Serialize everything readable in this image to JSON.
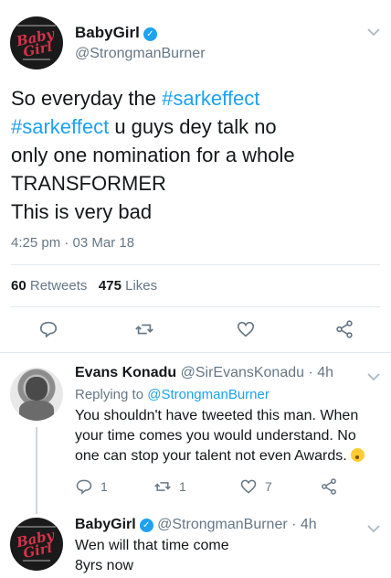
{
  "main_tweet": {
    "avatar": {
      "logo_text": "Baby Girl"
    },
    "display_name": "BabyGirl",
    "handle": "@StrongmanBurner",
    "text_lines": [
      {
        "plain": "So everyday the ",
        "tag": "#sarkeffect"
      },
      {
        "tag": "#sarkeffect",
        "plain": " u guys dey talk no"
      },
      {
        "plain": "only one nomination for a whole"
      },
      {
        "plain": "TRANSFORMER"
      },
      {
        "plain": "This is very bad"
      }
    ],
    "timestamp": "4:25 pm · 03 Mar 18",
    "retweets_count": "60",
    "retweets_label": "Retweets",
    "likes_count": "475",
    "likes_label": "Likes"
  },
  "reply1": {
    "display_name": "Evans Konadu",
    "handle_time": "@SirEvansKonadu · 4h",
    "replying_prefix": "Replying to ",
    "replying_handle": "@StrongmanBurner",
    "text_lines": [
      "You shouldn't have tweeted this man. When",
      "your time comes you would understand. No",
      "one can stop your talent not even Awards."
    ],
    "reply_count": "1",
    "retweet_count": "1",
    "like_count": "7"
  },
  "reply2": {
    "display_name": "BabyGirl",
    "handle_time": "@StrongmanBurner · 4h",
    "text_lines": [
      "Wen will that time come",
      "8yrs now"
    ]
  },
  "icons": {
    "verified": "verified-badge-icon",
    "caret": "chevron-down-icon",
    "reply": "reply-icon",
    "retweet": "retweet-icon",
    "like": "heart-icon",
    "share": "share-icon"
  },
  "colors": {
    "accent": "#1da1f2",
    "secondary_text": "#657786",
    "primary_text": "#14171a"
  }
}
